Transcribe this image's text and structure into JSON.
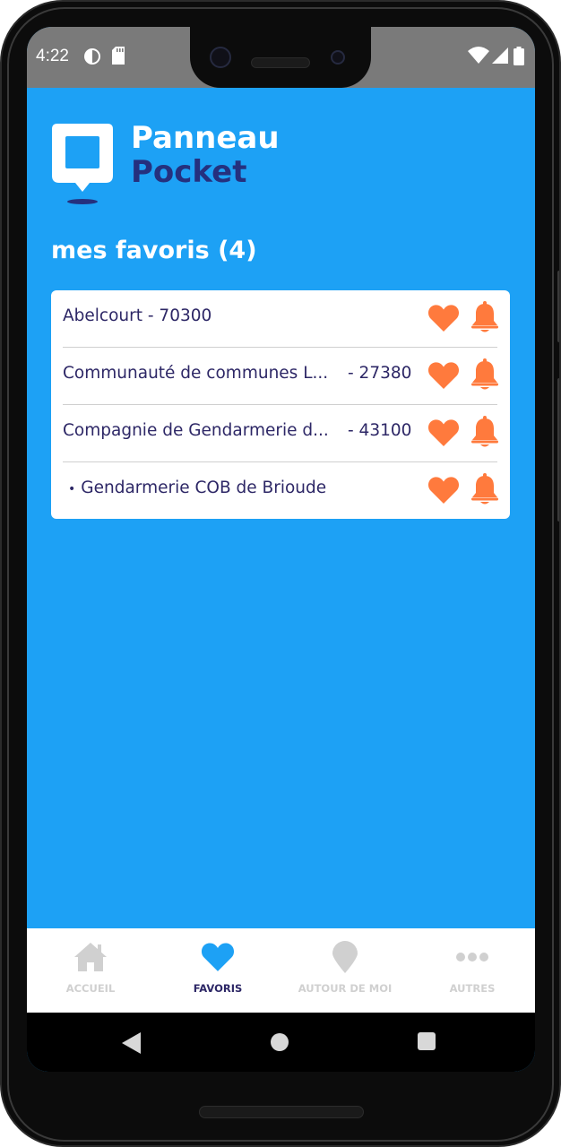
{
  "status_bar": {
    "time": "4:22",
    "left_icons": [
      "data-saver-icon",
      "sd-card-icon"
    ],
    "right_icons": [
      "wifi-icon",
      "signal-icon",
      "battery-icon"
    ]
  },
  "logo": {
    "line1": "Panneau",
    "line2": "Pocket"
  },
  "favorites": {
    "title": "mes favoris (4)",
    "items": [
      {
        "name": "Abelcourt - 70300",
        "code": "",
        "sub": false
      },
      {
        "name": "Communauté de communes L...",
        "code": "- 27380",
        "sub": false
      },
      {
        "name": "Compagnie de Gendarmerie d...",
        "code": "- 43100",
        "sub": false
      },
      {
        "name": "Gendarmerie COB de Brioude",
        "code": "",
        "sub": true
      }
    ]
  },
  "bottom_nav": {
    "items": [
      {
        "label": "ACCUEIL",
        "icon": "home-icon",
        "active": false
      },
      {
        "label": "FAVORIS",
        "icon": "heart-icon",
        "active": true
      },
      {
        "label": "AUTOUR DE MOI",
        "icon": "location-pin-icon",
        "active": false
      },
      {
        "label": "AUTRES",
        "icon": "more-icon",
        "active": false
      }
    ]
  },
  "colors": {
    "background": "#1da1f5",
    "accent_orange": "#ff7a3d",
    "text_dark": "#2d2766",
    "logo_dark": "#25307e",
    "nav_inactive": "#d0d0d0",
    "nav_active_icon": "#1da1f5"
  }
}
